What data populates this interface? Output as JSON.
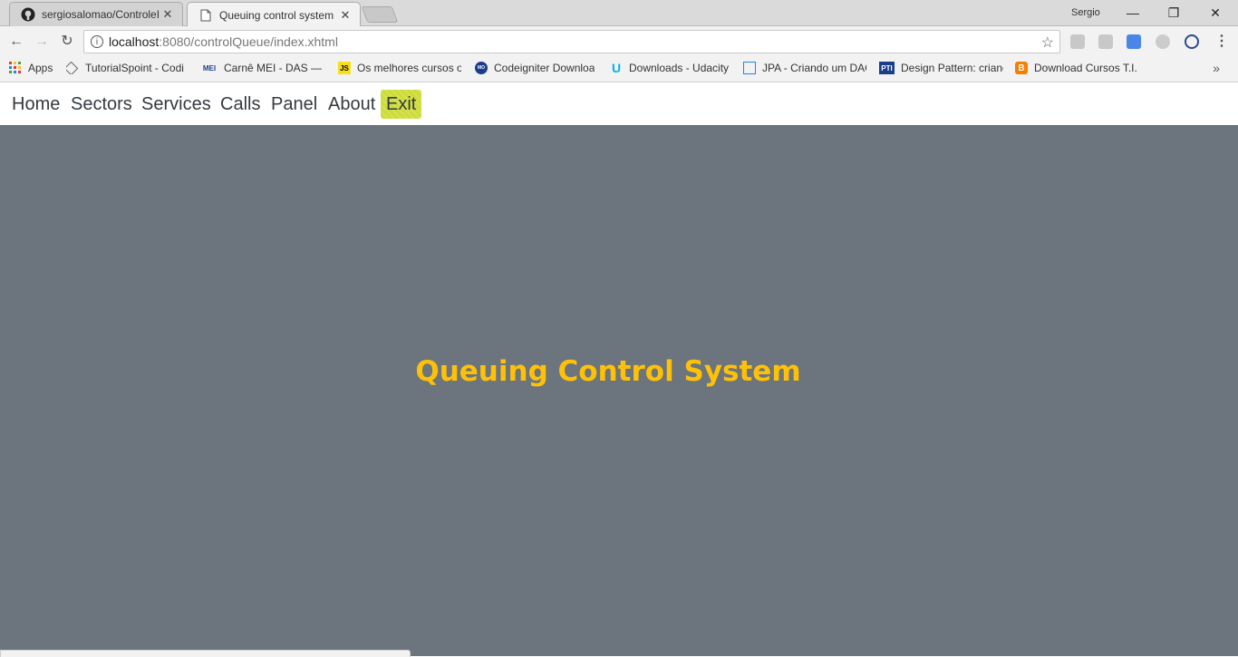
{
  "browser": {
    "tabs": [
      {
        "title": "sergiosalomao/ControleI",
        "icon": "github-icon",
        "active": false
      },
      {
        "title": "Queuing control system",
        "icon": "page-icon",
        "active": true
      }
    ],
    "profile_name": "Sergio",
    "url_host": "localhost",
    "url_path": ":8080/controlQueue/index.xhtml",
    "bookmarks": [
      {
        "label": "Apps",
        "icon": "apps-grid-icon"
      },
      {
        "label": "TutorialSpoint - Codi",
        "icon": "tutorialspoint-icon"
      },
      {
        "label": "Carnê MEI - DAS — P",
        "icon": "mei-icon"
      },
      {
        "label": "Os melhores cursos o",
        "icon": "js-icon"
      },
      {
        "label": "Codeigniter Downloa",
        "icon": "codeigniter-icon"
      },
      {
        "label": "Downloads - Udacity",
        "icon": "udacity-icon"
      },
      {
        "label": "JPA - Criando um DAC",
        "icon": "jpa-icon"
      },
      {
        "label": "Design Pattern: crianc",
        "icon": "pti-icon"
      },
      {
        "label": "Download Cursos T.I.",
        "icon": "blogger-icon"
      }
    ]
  },
  "nav": {
    "items": [
      "Home",
      "Sectors",
      "Services",
      "Calls",
      "Panel",
      "About"
    ],
    "exit_label": "Exit"
  },
  "main": {
    "heading": "Queuing Control System"
  },
  "colors": {
    "main_bg": "#6c757d",
    "heading": "#ffc107",
    "exit_bg": "#cddc39"
  }
}
